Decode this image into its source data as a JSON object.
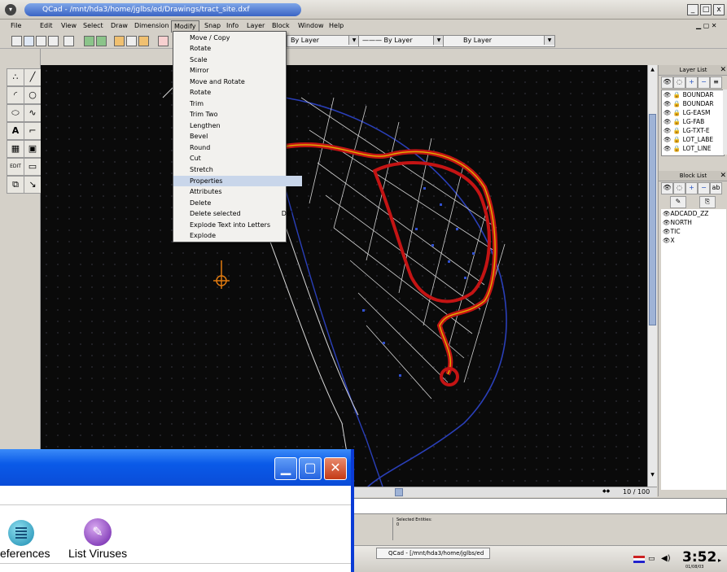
{
  "window": {
    "title": "QCad - /mnt/hda3/home/jglbs/ed/Drawings/tract_site.dxf",
    "buttons": [
      "_",
      "□",
      "x"
    ]
  },
  "menubar": [
    {
      "label": "File"
    },
    {
      "label": "Edit"
    },
    {
      "label": "View"
    },
    {
      "label": "Select"
    },
    {
      "label": "Draw"
    },
    {
      "label": "Dimension"
    },
    {
      "label": "Modify"
    },
    {
      "label": "Snap"
    },
    {
      "label": "Info"
    },
    {
      "label": "Layer"
    },
    {
      "label": "Block"
    },
    {
      "label": "Window"
    },
    {
      "label": "Help"
    }
  ],
  "toolbar": {
    "combos": [
      "By Layer",
      "By Layer",
      "By Layer"
    ]
  },
  "modify_menu": {
    "items": [
      {
        "label": "Move / Copy",
        "shortcut": ""
      },
      {
        "label": "Rotate",
        "shortcut": ""
      },
      {
        "label": "Scale",
        "shortcut": ""
      },
      {
        "label": "Mirror",
        "shortcut": ""
      },
      {
        "label": "Move and Rotate",
        "shortcut": ""
      },
      {
        "label": "Rotate",
        "shortcut": ""
      },
      {
        "label": "Trim",
        "shortcut": ""
      },
      {
        "label": "Trim Two",
        "shortcut": ""
      },
      {
        "label": "Lengthen",
        "shortcut": ""
      },
      {
        "label": "Bevel",
        "shortcut": ""
      },
      {
        "label": "Round",
        "shortcut": ""
      },
      {
        "label": "Cut",
        "shortcut": ""
      },
      {
        "label": "Stretch",
        "shortcut": ""
      },
      {
        "label": "Properties",
        "shortcut": "",
        "highlighted": true
      },
      {
        "label": "Attributes",
        "shortcut": ""
      },
      {
        "label": "Delete",
        "shortcut": ""
      },
      {
        "label": "Delete selected",
        "shortcut": "Del"
      },
      {
        "label": "Explode Text into Letters",
        "shortcut": ""
      },
      {
        "label": "Explode",
        "shortcut": ""
      }
    ]
  },
  "layer_list": {
    "title": "Layer List",
    "layers": [
      "BOUNDAR",
      "BOUNDAR",
      "LG-EASM",
      "LG-FAB",
      "LG-TXT-E",
      "LOT_LABE",
      "LOT_LINE"
    ]
  },
  "block_list": {
    "title": "Block List",
    "blocks": [
      "ADCADD_ZZ",
      "NORTH",
      "TIC",
      "X"
    ]
  },
  "status": {
    "page": "10 / 100",
    "selected_label": "Selected Entities:",
    "selected_value": "0"
  },
  "taskbar": {
    "task": "QCad - [/mnt/hda3/home/jglbs/ed",
    "clock": "3:52",
    "date": "01/08/03"
  },
  "xp_window": {
    "labels": [
      "eferences",
      "List Viruses"
    ]
  },
  "colors": {
    "canvas_bg": "#0a0a0a",
    "road_red": "#c41414",
    "road_yellow": "#e0b000",
    "lot_white": "#e0e0e0",
    "boundary_blue": "#2a3fb8",
    "xp_blue": "#0a5ae8"
  }
}
